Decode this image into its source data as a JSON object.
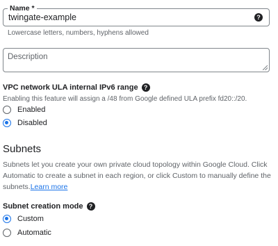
{
  "name_field": {
    "label": "Name *",
    "value": "twingate-example",
    "help_icon": "help-icon",
    "hint": "Lowercase letters, numbers, hyphens allowed"
  },
  "description_field": {
    "placeholder": "Description"
  },
  "ipv6": {
    "label": "VPC network ULA internal IPv6 range",
    "help_icon": "help-icon",
    "description": "Enabling this feature will assign a /48 from Google defined ULA prefix fd20::/20.",
    "options": [
      {
        "label": "Enabled",
        "checked": false
      },
      {
        "label": "Disabled",
        "checked": true
      }
    ]
  },
  "subnets": {
    "title": "Subnets",
    "description": "Subnets let you create your own private cloud topology within Google Cloud. Click Automatic to create a subnet in each region, or click Custom to manually define the subnets.",
    "learn_more": "Learn more",
    "mode_label": "Subnet creation mode",
    "mode_help_icon": "help-icon",
    "modes": [
      {
        "label": "Custom",
        "checked": true
      },
      {
        "label": "Automatic",
        "checked": false
      }
    ]
  },
  "colors": {
    "accent": "#1a73e8",
    "text": "#202124",
    "secondary_text": "#5f6368",
    "border": "#80868b"
  }
}
